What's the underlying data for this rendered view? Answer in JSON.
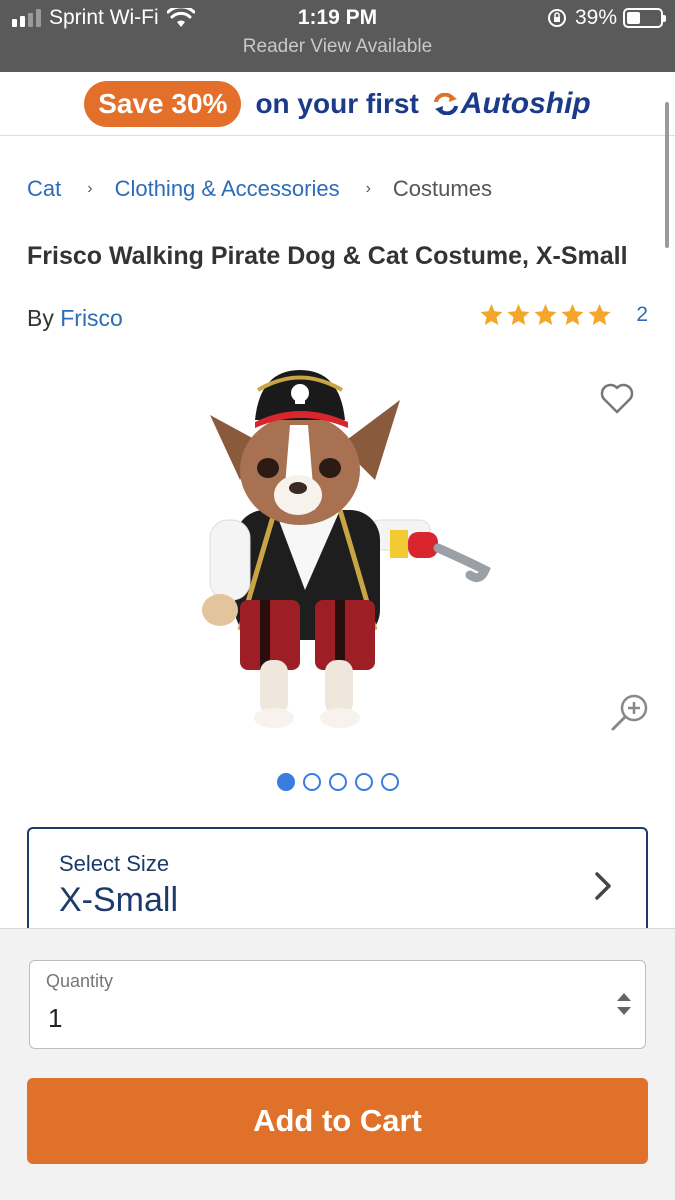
{
  "status_bar": {
    "carrier": "Sprint Wi-Fi",
    "time": "1:19 PM",
    "reader_view": "Reader View Available",
    "battery": "39%",
    "battery_level": 0.39
  },
  "promo": {
    "badge": "Save 30%",
    "text": "on your first",
    "brand": "Autoship",
    "colors": {
      "badge": "#e36f2a",
      "brand": "#1c3a8a"
    }
  },
  "breadcrumb": {
    "items": [
      "Cat",
      "Clothing & Accessories",
      "Costumes"
    ],
    "separator": "›"
  },
  "product": {
    "title": "Frisco Walking Pirate Dog & Cat Costume, X-Small",
    "by_label": "By",
    "brand": "Frisco",
    "rating": 5,
    "rating_max": 5,
    "review_count": "2"
  },
  "gallery": {
    "image_count": 5,
    "active_index": 0
  },
  "size": {
    "label": "Select Size",
    "value": "X-Small"
  },
  "quantity": {
    "label": "Quantity",
    "value": "1"
  },
  "cart": {
    "button_label": "Add to Cart",
    "color": "#e0712a"
  },
  "icons": [
    "signal-icon",
    "wifi-icon",
    "orientation-lock-icon",
    "battery-icon",
    "autoship-icon",
    "star-icon",
    "heart-icon",
    "zoom-in-icon",
    "chevron-right-icon",
    "stepper-arrows-icon"
  ]
}
